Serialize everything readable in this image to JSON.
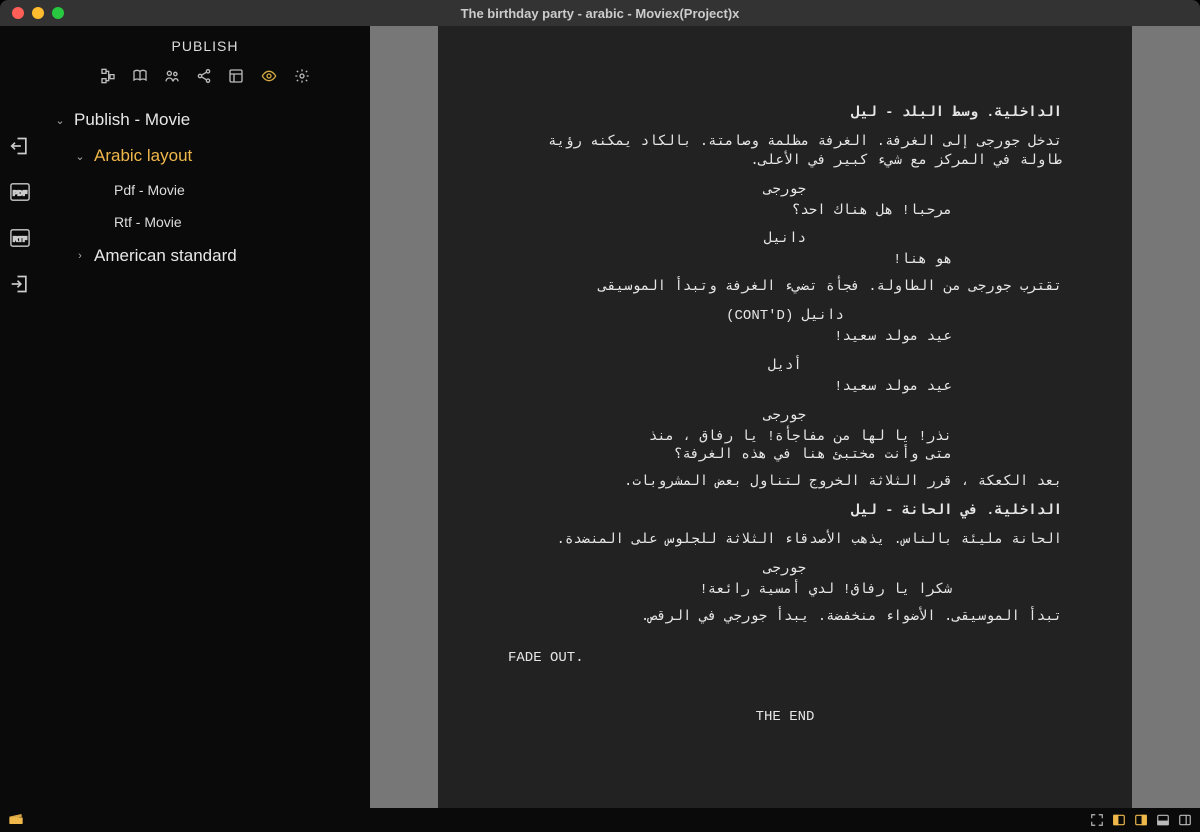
{
  "window": {
    "title": "The birthday party - arabic - Moviex(Project)x"
  },
  "sidebar": {
    "title": "PUBLISH",
    "toolbar_icons": [
      "tree-icon",
      "book-icon",
      "users-icon",
      "share-icon",
      "layout-icon",
      "eye-icon",
      "gear-icon"
    ],
    "tree": {
      "root": "Publish - Movie",
      "arabic": "Arabic layout",
      "pdf": "Pdf - Movie",
      "rtf": "Rtf - Movie",
      "american": "American standard"
    }
  },
  "script": {
    "slug1": "الداخلية. وسط البلد - ليل",
    "action1": "تدخل جورجى إلى الغرفة. الغرفة مظلمة وصامتة. بالكاد يمكنه رؤية طاولة في المركز مع شيء كبير في الأعلى.",
    "char_georgi": "جورجى",
    "dlg1": "مرحبا! هل هناك احد؟",
    "char_daniel": "دانيل",
    "dlg2": "هو هنا!",
    "action2": "تقترب جورجى من الطاولة. فجأة تضيء الغرفة وتبدأ الموسيقى",
    "char_daniel_contd": "دانيل (CONT'D)",
    "dlg3": "عيد مولد سعيد!",
    "char_adel": "أديل",
    "dlg4": "عيد مولد سعيد!",
    "dlg5": "نذر! يا لها من مفاجأة! يا رفاق ، منذ متى وأنت مختبئ هنا في هذه الغرفة؟",
    "action3": "بعد الكعكة ، قرر الثلاثة الخروج لتناول بعض المشروبات.",
    "slug2": "الداخلية. في الحانة - ليل",
    "action4": "الحانة مليئة بالناس. يذهب الأصدقاء الثلاثة للجلوس على المنضدة.",
    "dlg6": "شكرا يا رفاق! لدي أمسية رائعة!",
    "action5": "تبدأ الموسيقى. الأضواء منخفضة. يبدأ جورجي في الرقص.",
    "fadeout": "FADE OUT.",
    "theend": "THE END"
  }
}
